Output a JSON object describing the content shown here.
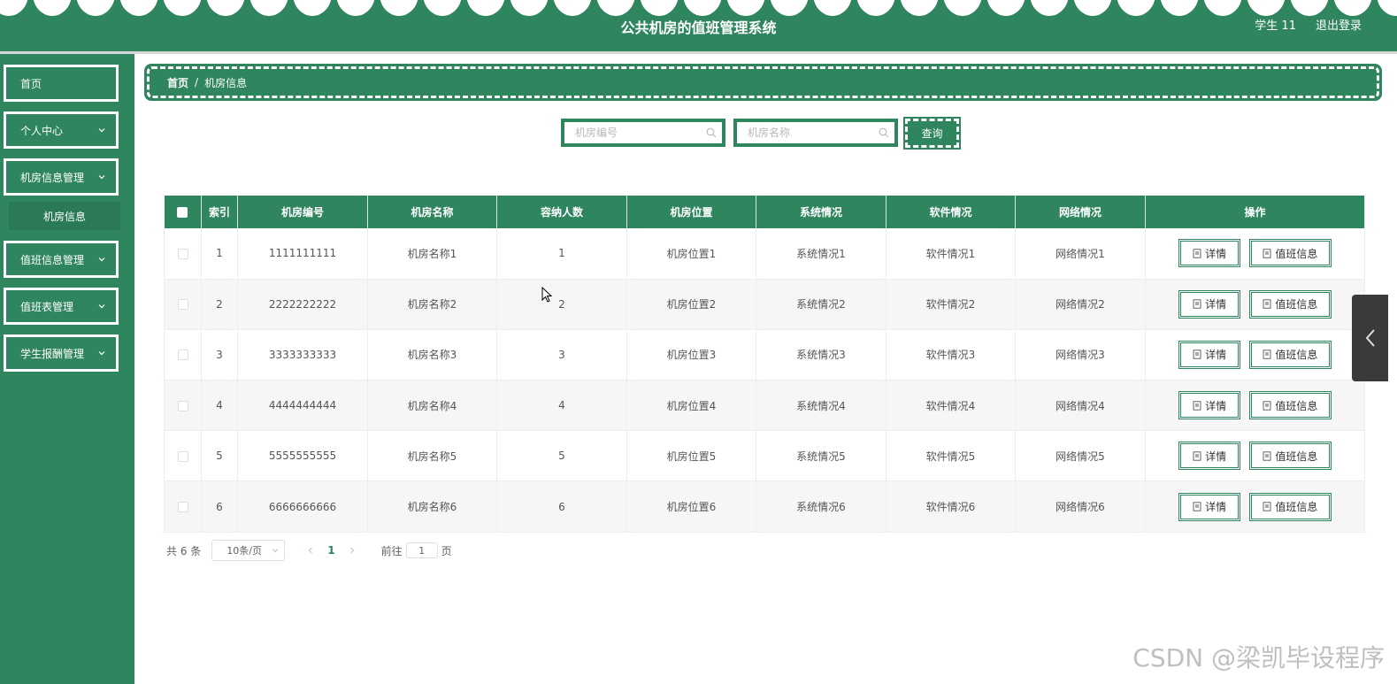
{
  "header": {
    "title": "公共机房的值班管理系统",
    "user": "学生 11",
    "logout": "退出登录"
  },
  "sidebar": {
    "items": [
      {
        "label": "首页"
      },
      {
        "label": "个人中心"
      },
      {
        "label": "机房信息管理"
      },
      {
        "label": "值班信息管理"
      },
      {
        "label": "值班表管理"
      },
      {
        "label": "学生报酬管理"
      }
    ],
    "sub_item": "机房信息"
  },
  "breadcrumb": {
    "home": "首页",
    "separator": "/",
    "current": "机房信息"
  },
  "search": {
    "room_no_placeholder": "机房编号",
    "room_name_placeholder": "机房名称",
    "query_label": "查询"
  },
  "table": {
    "columns": [
      "索引",
      "机房编号",
      "机房名称",
      "容纳人数",
      "机房位置",
      "系统情况",
      "软件情况",
      "网络情况",
      "操作"
    ],
    "rows": [
      {
        "index": "1",
        "no": "1111111111",
        "name": "机房名称1",
        "capacity": "1",
        "location": "机房位置1",
        "system": "系统情况1",
        "software": "软件情况1",
        "network": "网络情况1"
      },
      {
        "index": "2",
        "no": "2222222222",
        "name": "机房名称2",
        "capacity": "2",
        "location": "机房位置2",
        "system": "系统情况2",
        "software": "软件情况2",
        "network": "网络情况2"
      },
      {
        "index": "3",
        "no": "3333333333",
        "name": "机房名称3",
        "capacity": "3",
        "location": "机房位置3",
        "system": "系统情况3",
        "software": "软件情况3",
        "network": "网络情况3"
      },
      {
        "index": "4",
        "no": "4444444444",
        "name": "机房名称4",
        "capacity": "4",
        "location": "机房位置4",
        "system": "系统情况4",
        "software": "软件情况4",
        "network": "网络情况4"
      },
      {
        "index": "5",
        "no": "5555555555",
        "name": "机房名称5",
        "capacity": "5",
        "location": "机房位置5",
        "system": "系统情况5",
        "software": "软件情况5",
        "network": "网络情况5"
      },
      {
        "index": "6",
        "no": "6666666666",
        "name": "机房名称6",
        "capacity": "6",
        "location": "机房位置6",
        "system": "系统情况6",
        "software": "软件情况6",
        "network": "网络情况6"
      }
    ],
    "detail_label": "详情",
    "duty_label": "值班信息"
  },
  "pagination": {
    "total": "共 6 条",
    "page_size": "10条/页",
    "current_page": "1",
    "goto_prefix": "前往",
    "goto_value": "1",
    "goto_suffix": "页"
  },
  "watermark": "CSDN @梁凯毕设程序",
  "colors": {
    "primary": "#2f855e",
    "sub_item_bg": "#2a7a56",
    "float_tab": "#3a3a3a"
  },
  "icons": [
    "search-icon",
    "chevron-down-icon",
    "document-icon",
    "chevron-left-icon",
    "mouse-cursor-icon"
  ]
}
